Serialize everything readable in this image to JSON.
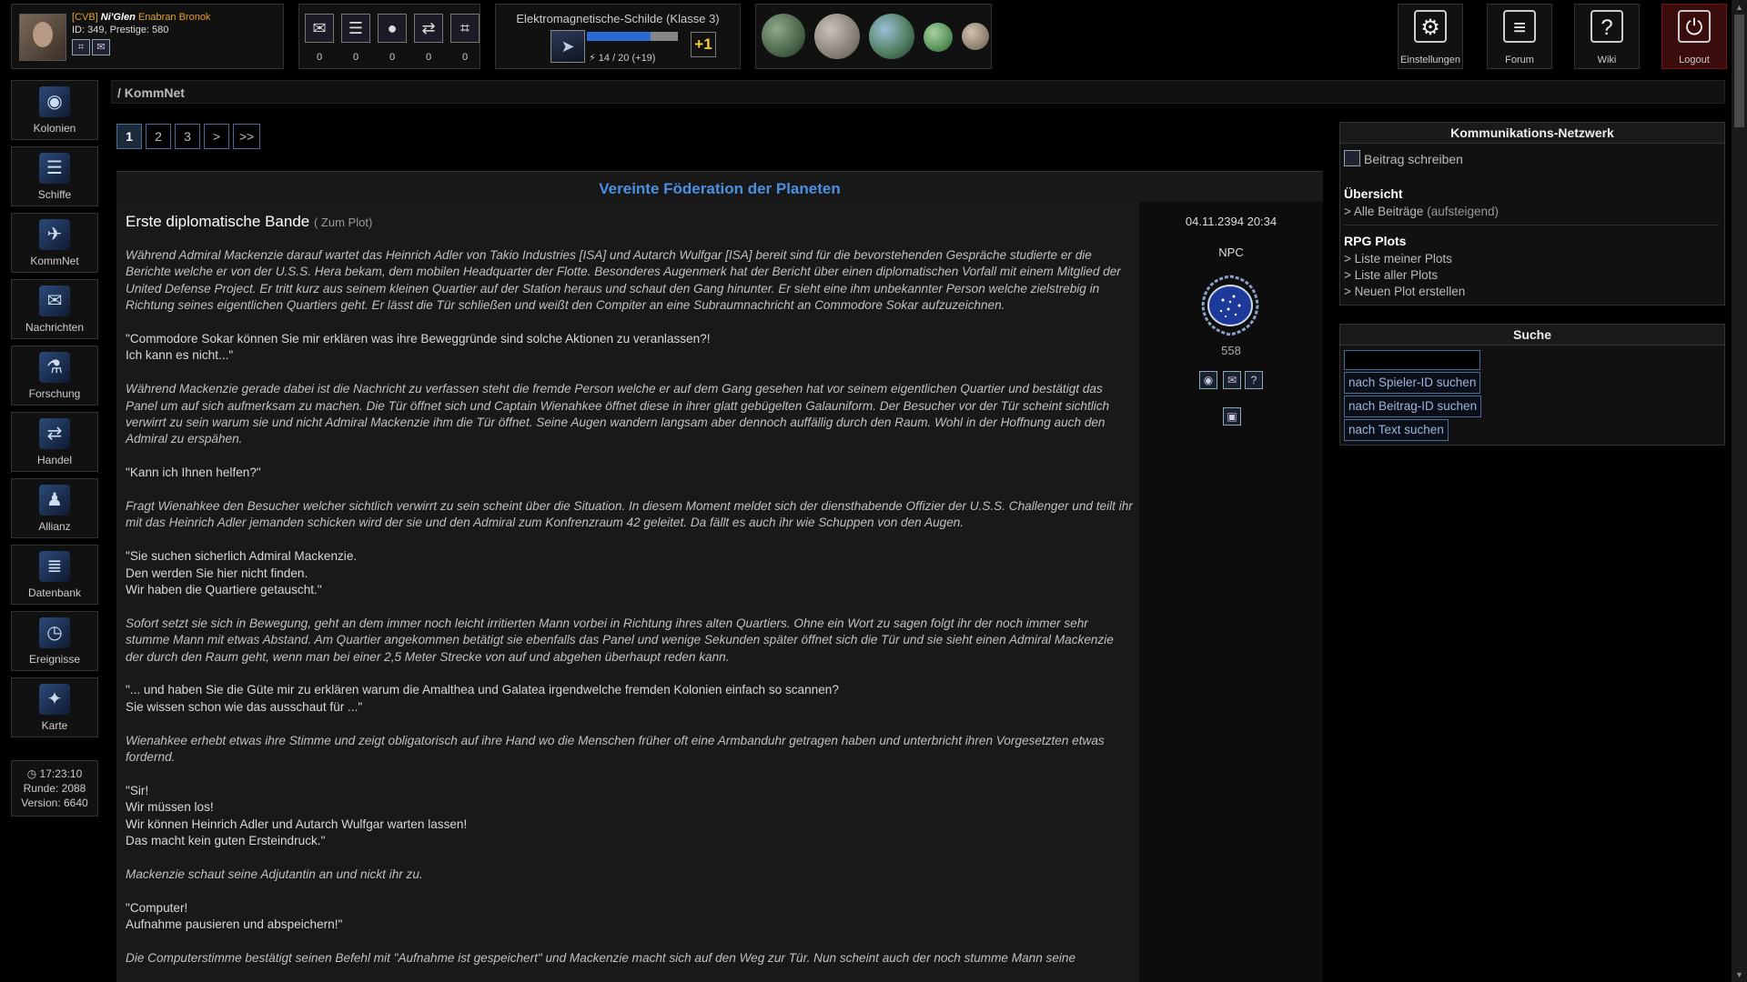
{
  "profile": {
    "tag": "[CVB]",
    "name": "Ni'Glen",
    "race": "Enabran Bronok",
    "stats": "ID: 349, Prestige: 580"
  },
  "quick": [
    {
      "icon": "envelope-icon",
      "glyph": "✉",
      "count": "0"
    },
    {
      "icon": "ships-icon",
      "glyph": "☰",
      "count": "0"
    },
    {
      "icon": "planet-icon",
      "glyph": "●",
      "count": "0"
    },
    {
      "icon": "trade-icon",
      "glyph": "⇄",
      "count": "0"
    },
    {
      "icon": "scan-icon",
      "glyph": "⌗",
      "count": "0"
    }
  ],
  "shield": {
    "title": "Elektromagnetische-Schilde (Klasse 3)",
    "value_text": "14 / 20 (+19)",
    "fill_fraction": 0.7,
    "plus": "+1"
  },
  "top_buttons": {
    "settings": "Einstellungen",
    "forum": "Forum",
    "wiki": "Wiki",
    "logout": "Logout"
  },
  "nav": [
    {
      "label": "Kolonien",
      "icon": "colonies-icon",
      "glyph": "◉"
    },
    {
      "label": "Schiffe",
      "icon": "ships-icon",
      "glyph": "☰"
    },
    {
      "label": "KommNet",
      "icon": "kommnet-icon",
      "glyph": "✈"
    },
    {
      "label": "Nachrichten",
      "icon": "messages-icon",
      "glyph": "✉"
    },
    {
      "label": "Forschung",
      "icon": "research-icon",
      "glyph": "⚗"
    },
    {
      "label": "Handel",
      "icon": "trade-icon",
      "glyph": "⇄"
    },
    {
      "label": "Allianz",
      "icon": "alliance-icon",
      "glyph": "♟"
    },
    {
      "label": "Datenbank",
      "icon": "database-icon",
      "glyph": "≣"
    },
    {
      "label": "Ereignisse",
      "icon": "events-icon",
      "glyph": "◷"
    },
    {
      "label": "Karte",
      "icon": "map-icon",
      "glyph": "✦"
    }
  ],
  "clock": {
    "time": "17:23:10",
    "round": "Runde: 2088",
    "version": "Version: 6640"
  },
  "breadcrumb": "/ KommNet",
  "pagination": [
    "1",
    "2",
    "3",
    ">",
    ">>"
  ],
  "post": {
    "faction": "Vereinte Föderation der Planeten",
    "title": "Erste diplomatische Bande",
    "plot_open": "( ",
    "plot_link": "Zum Plot",
    "plot_close": ")",
    "date": "04.11.2394 20:34",
    "author": "NPC",
    "count": "558",
    "paragraphs": [
      {
        "italic": true,
        "text": "Während Admiral Mackenzie darauf wartet das Heinrich Adler von Takio Industries [ISA] und Autarch Wulfgar [ISA] bereit sind für die bevorstehenden Gespräche studierte er die Berichte welche er von der U.S.S. Hera bekam, dem mobilen Headquarter der Flotte. Besonderes Augenmerk hat der Bericht über einen diplomatischen Vorfall mit einem Mitglied der United Defense Project. Er tritt kurz aus seinem kleinen Quartier auf der Station heraus und schaut den Gang hinunter. Er sieht eine ihm unbekannter Person welche zielstrebig in Richtung seines eigentlichen Quartiers geht. Er lässt die Tür schließen und weißt den Compiter an eine Subraumnachricht an Commodore Sokar aufzuzeichnen."
      },
      {
        "italic": false,
        "text": "\"Commodore Sokar können Sie mir erklären was ihre Beweggründe sind solche Aktionen zu veranlassen?!\nIch kann es nicht...\""
      },
      {
        "italic": true,
        "text": "Während Mackenzie gerade dabei ist die Nachricht zu verfassen steht die fremde Person welche er auf dem Gang gesehen hat vor seinem eigentlichen Quartier und bestätigt das Panel um auf sich aufmerksam zu machen. Die Tür öffnet sich und Captain Wienahkee öffnet diese in ihrer glatt gebügelten Galauniform. Der Besucher vor der Tür scheint sichtlich verwirrt zu sein warum sie und nicht Admiral Mackenzie ihm die Tür öffnet. Seine Augen wandern langsam aber dennoch auffällig durch den Raum. Wohl in der Hoffnung auch den Admiral zu erspähen."
      },
      {
        "italic": false,
        "text": "\"Kann ich Ihnen helfen?\""
      },
      {
        "italic": true,
        "text": "Fragt Wienahkee den Besucher welcher sichtlich verwirrt zu sein scheint über die Situation. In diesem Moment meldet sich der diensthabende Offizier der U.S.S. Challenger und teilt ihr mit das Heinrich Adler jemanden schicken wird der sie und den Admiral zum Konfrenzraum 42 geleitet. Da fällt es auch ihr wie Schuppen von den Augen."
      },
      {
        "italic": false,
        "text": "\"Sie suchen sicherlich Admiral Mackenzie.\nDen werden Sie hier nicht finden.\nWir haben die Quartiere getauscht.\""
      },
      {
        "italic": true,
        "text": "Sofort setzt sie sich in Bewegung, geht an dem immer noch leicht irritierten Mann vorbei in Richtung ihres alten Quartiers. Ohne ein Wort zu sagen folgt ihr der noch immer sehr stumme Mann mit etwas Abstand. Am Quartier angekommen betätigt sie ebenfalls das Panel und wenige Sekunden später öffnet sich die Tür und sie sieht einen Admiral Mackenzie der durch den Raum geht, wenn man bei einer 2,5 Meter Strecke von auf und abgehen überhaupt reden kann."
      },
      {
        "italic": false,
        "text": "\"... und haben Sie die Güte mir zu erklären warum die Amalthea und Galatea irgendwelche fremden Kolonien einfach so scannen?\nSie wissen schon wie das ausschaut für ...\""
      },
      {
        "italic": true,
        "text": "Wienahkee erhebt etwas ihre Stimme und zeigt obligatorisch auf ihre Hand wo die Menschen früher oft eine Armbanduhr getragen haben und unterbricht ihren Vorgesetzten etwas fordernd."
      },
      {
        "italic": false,
        "text": "\"Sir!\nWir müssen los!\nWir können Heinrich Adler und Autarch Wulfgar warten lassen!\nDas macht kein guten Ersteindruck.\""
      },
      {
        "italic": true,
        "text": "Mackenzie schaut seine Adjutantin an und nickt ihr zu."
      },
      {
        "italic": false,
        "text": "\"Computer!\nAufnahme pausieren und abspeichern!\""
      },
      {
        "italic": true,
        "text": "Die Computerstimme bestätigt seinen Befehl mit \"Aufnahme ist gespeichert\" und Mackenzie macht sich auf den Weg zur Tür. Nun scheint auch der noch stumme Mann seine"
      }
    ]
  },
  "kommnet": {
    "title": "Kommunikations-Netzwerk",
    "write": "Beitrag schreiben",
    "overview": "Übersicht",
    "all_posts": "> Alle Beiträge",
    "ascending": "(aufsteigend)",
    "rpg_plots": "RPG Plots",
    "my_plots": "> Liste meiner Plots",
    "all_plots": "> Liste aller Plots",
    "new_plot": "> Neuen Plot erstellen"
  },
  "search": {
    "title": "Suche",
    "input_value": "",
    "by_player": "nach Spieler-ID suchen",
    "by_post": "nach Beitrag-ID suchen",
    "by_text": "nach Text suchen"
  },
  "colors": {
    "accent": "#4a90e2",
    "highlight": "#e0a030",
    "logout": "#3a0c0c"
  }
}
